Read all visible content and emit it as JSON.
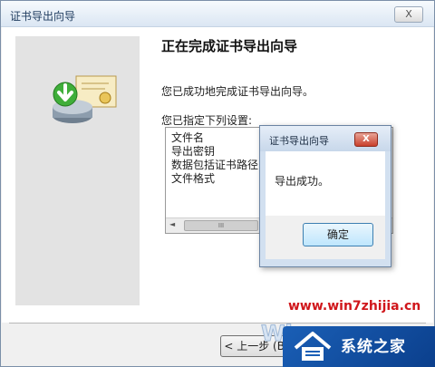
{
  "window": {
    "title": "证书导出向导",
    "close_label": "X"
  },
  "wizard": {
    "heading": "正在完成证书导出向导",
    "success_text": "您已成功地完成证书导出向导。",
    "settings_label": "您已指定下列设置:",
    "settings_items": [
      "文件名",
      "导出密钥",
      "数据包括证书路径中",
      "文件格式"
    ],
    "scroll_left": "◄",
    "scroll_thumb": "III",
    "back_button": "< 上一步 (B)"
  },
  "dialog": {
    "title": "证书导出向导",
    "close_label": "X",
    "message": "导出成功。",
    "ok_label": "确定"
  },
  "watermark": {
    "url": "www.win7zhijia.cn",
    "brand": "系统之家",
    "logo_text": "Win"
  }
}
